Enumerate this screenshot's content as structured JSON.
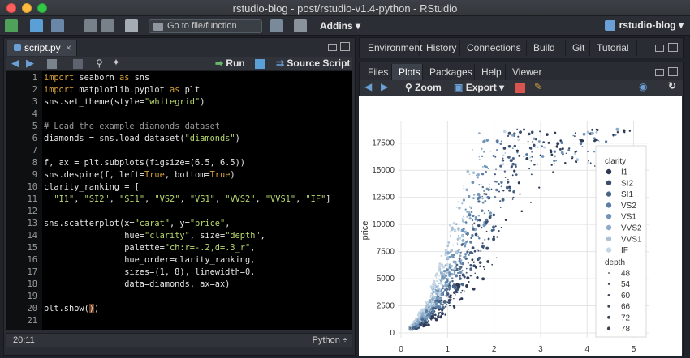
{
  "window": {
    "title": "rstudio-blog - post/rstudio-v1.4-python - RStudio"
  },
  "toolbar": {
    "goto_label": "Go to file/function",
    "addins_label": "Addins",
    "project_label": "rstudio-blog"
  },
  "editor": {
    "tab_label": "script.py",
    "run_label": "Run",
    "source_label": "Source Script",
    "cursor_pos": "20:11",
    "language": "Python",
    "line_numbers": [
      "1",
      "2",
      "3",
      "4",
      "5",
      "6",
      "7",
      "8",
      "9",
      "10",
      "11",
      "12",
      "13",
      "14",
      "15",
      "16",
      "17",
      "18",
      "19",
      "20",
      "21"
    ]
  },
  "upper_right": {
    "tabs": [
      "Environment",
      "History",
      "Connections",
      "Build",
      "Git",
      "Tutorial"
    ]
  },
  "lower_right": {
    "tabs": [
      "Files",
      "Plots",
      "Packages",
      "Help",
      "Viewer"
    ],
    "active_tab": "Plots",
    "zoom_label": "Zoom",
    "export_label": "Export"
  },
  "chart_data": {
    "type": "scatter",
    "xlabel": "",
    "ylabel": "price",
    "xticks": [
      "0",
      "1",
      "2",
      "3",
      "4",
      "5"
    ],
    "yticks": [
      "0",
      "2500",
      "5000",
      "7500",
      "10000",
      "12500",
      "15000",
      "17500"
    ],
    "xlim": [
      0,
      5.2
    ],
    "ylim": [
      0,
      18900
    ],
    "grid": true,
    "legend_title_hue": "clarity",
    "hue_levels": [
      "I1",
      "SI2",
      "SI1",
      "VS2",
      "VS1",
      "VVS2",
      "VVS1",
      "IF"
    ],
    "hue_colors": [
      "#2e3a55",
      "#3a4d6e",
      "#4a6488",
      "#5a7ea4",
      "#6f95b8",
      "#8cabc9",
      "#a9c2d8",
      "#c4d6e4"
    ],
    "legend_title_size": "depth",
    "size_levels": [
      "48",
      "54",
      "60",
      "66",
      "72",
      "78"
    ],
    "legend_position": "upper right"
  },
  "colors": {
    "accent": "#6ba0d6",
    "background": "#292d33"
  }
}
